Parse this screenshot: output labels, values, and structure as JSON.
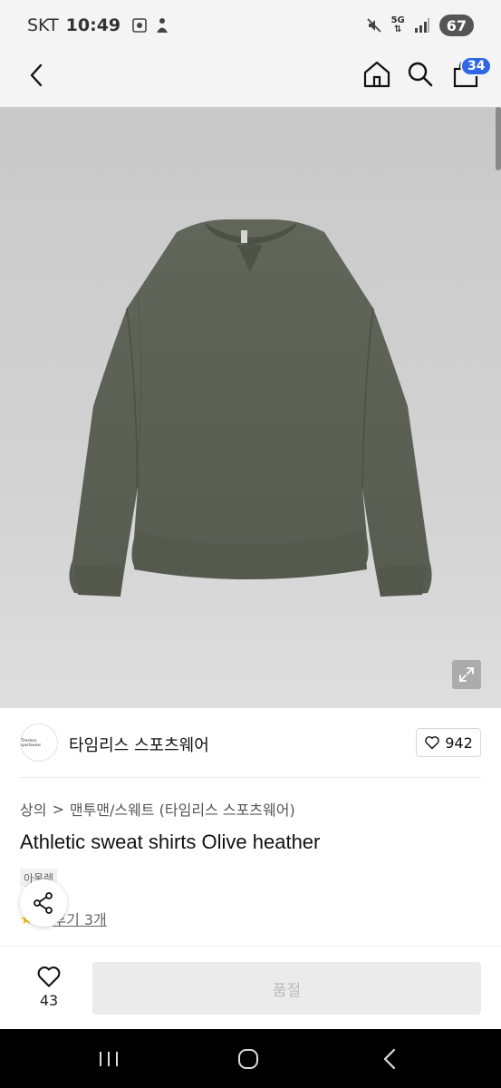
{
  "status_bar": {
    "carrier": "SKT",
    "time": "10:49",
    "network": "5G",
    "battery": "67"
  },
  "nav": {
    "cart_count": "34"
  },
  "brand": {
    "logo_text": "Timeless sportswear",
    "name": "타임리스 스포츠웨어",
    "like_count": "942"
  },
  "breadcrumb": {
    "category": "상의",
    "separator": ">",
    "subcategory": "맨투맨/스웨트 (타임리스 스포츠웨어)"
  },
  "product": {
    "title": "Athletic sweat shirts Olive heather",
    "badge": "아울렛",
    "review_link": "후기 3개"
  },
  "bottom_bar": {
    "wish_count": "43",
    "soldout_label": "품절"
  },
  "colors": {
    "accent": "#2f67e6",
    "garment": "#5d6155"
  }
}
